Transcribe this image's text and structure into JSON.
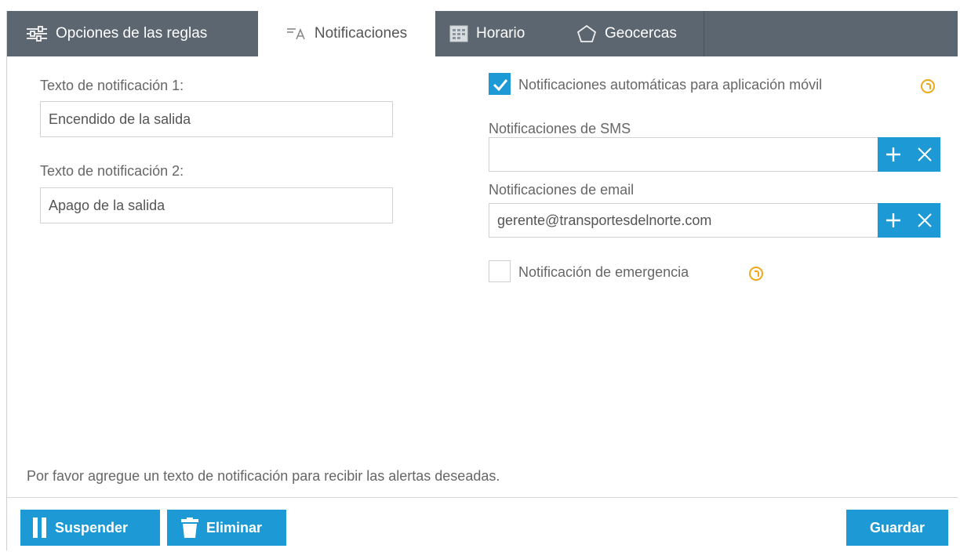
{
  "tabs": [
    {
      "label": "Opciones de las reglas",
      "icon": "sliders-icon"
    },
    {
      "label": "Notificaciones",
      "icon": "notification-messages-icon"
    },
    {
      "label": "Horario",
      "icon": "calendar-icon"
    },
    {
      "label": "Geocercas",
      "icon": "pentagon-icon"
    }
  ],
  "left": {
    "notif1_label": "Texto de notificación 1:",
    "notif1_value": "Encendido de la salida",
    "notif2_label": "Texto de notificación 2:",
    "notif2_value": "Apago de la salida"
  },
  "right": {
    "auto_push_label": "Notificaciones automáticas para aplicación móvil",
    "auto_push_checked": true,
    "sms_label": "Notificaciones de SMS",
    "sms_value": "",
    "email_label": "Notificaciones de email",
    "email_value": "gerente@transportesdelnorte.com",
    "emergency_label": "Notificación de emergencia",
    "emergency_checked": false
  },
  "hint": "Por favor agregue un texto de notificación para recibir las alertas deseadas.",
  "buttons": {
    "suspend": "Suspender",
    "delete": "Eliminar",
    "save": "Guardar"
  },
  "colors": {
    "accent": "#1d9ad6",
    "tabbar": "#5b6670",
    "help": "#f0a81a"
  }
}
